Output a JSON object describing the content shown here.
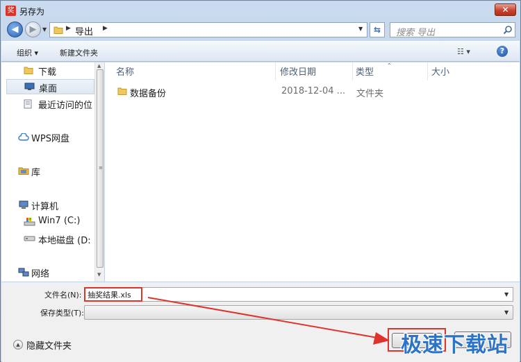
{
  "window": {
    "title": "另存为",
    "app_icon_glyph": "奖",
    "close_glyph": "✕"
  },
  "address": {
    "crumb": "导出",
    "search_placeholder": "搜索 导出"
  },
  "toolbar": {
    "organize": "组织 ▾",
    "new_folder": "新建文件夹",
    "views": "☷ ▾",
    "help": "?"
  },
  "nav": {
    "items": [
      {
        "label": "下载",
        "icon": "folder-icon"
      },
      {
        "label": "桌面",
        "icon": "desktop-icon"
      },
      {
        "label": "最近访问的位",
        "icon": "recent-places-icon"
      },
      {
        "label": "WPS网盘",
        "icon": "cloud-icon"
      },
      {
        "label": "库",
        "icon": "library-icon"
      },
      {
        "label": "计算机",
        "icon": "computer-icon"
      },
      {
        "label": "Win7 (C:)",
        "icon": "drive-c-icon"
      },
      {
        "label": "本地磁盘 (D:",
        "icon": "drive-d-icon"
      },
      {
        "label": "网络",
        "icon": "network-icon"
      }
    ]
  },
  "files": {
    "columns": [
      "名称",
      "修改日期",
      "类型",
      "大小"
    ],
    "rows": [
      {
        "name": "数据备份",
        "date": "2018-12-04 ...",
        "type": "文件夹",
        "size": ""
      }
    ]
  },
  "form": {
    "filename_label": "文件名(N):",
    "filename_value": "抽奖结果.xls",
    "type_label": "保存类型(T):",
    "type_value": "",
    "hide_folders": "隐藏文件夹"
  },
  "watermark": "极速下载站",
  "colors": {
    "annotation": "#e0332b",
    "watermark": "#2d73c7"
  }
}
